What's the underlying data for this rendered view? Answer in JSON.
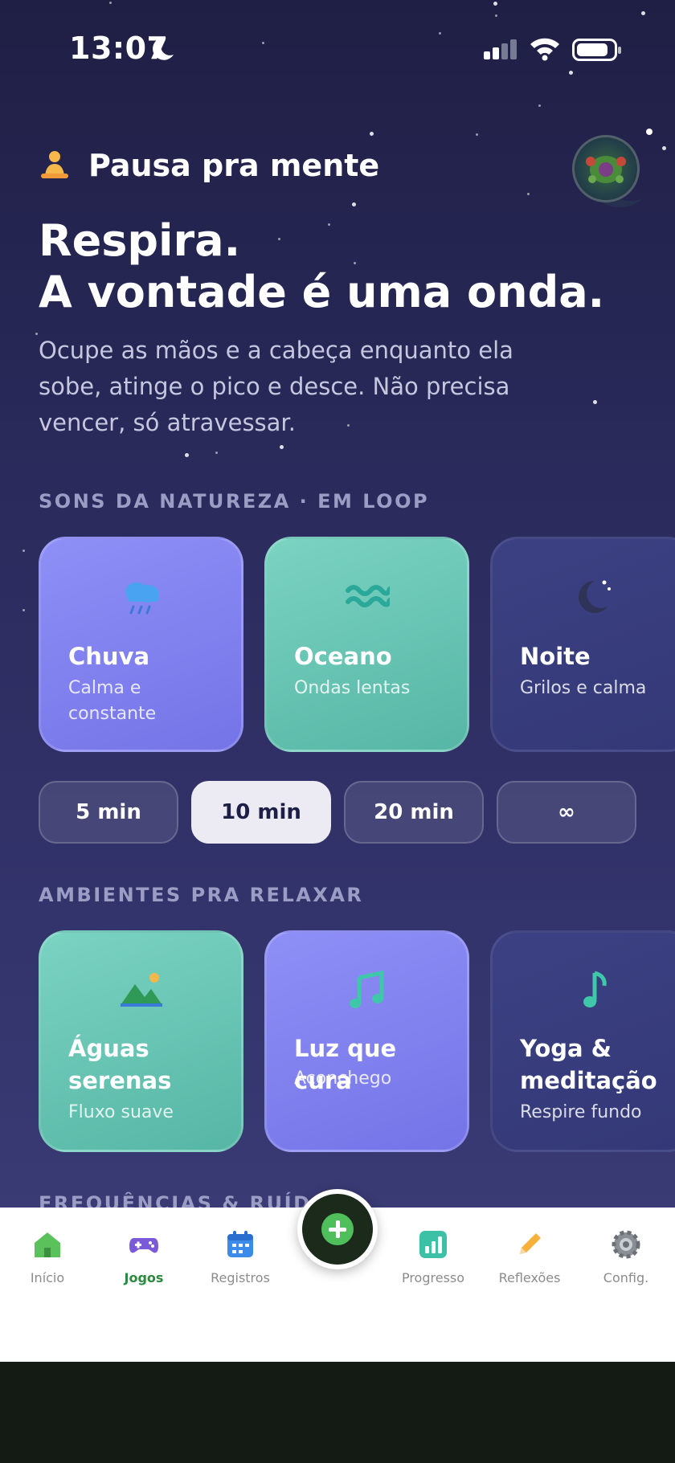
{
  "status_bar": {
    "time": "13:07"
  },
  "header": {
    "brand_title": "Pausa pra mente",
    "headline_line1": "Respira.",
    "headline_line2": "A vontade é uma onda.",
    "subtitle": "Ocupe as mãos e a cabeça enquanto ela sobe, atinge o pico e desce. Não precisa vencer, só atravessar."
  },
  "sounds_section": {
    "label": "SONS DA NATUREZA · EM LOOP",
    "cards": [
      {
        "title": "Chuva",
        "subtitle": "Calma e constante",
        "icon": "rain-cloud-icon"
      },
      {
        "title": "Oceano",
        "subtitle": "Ondas lentas",
        "icon": "waves-icon"
      },
      {
        "title": "Noite",
        "subtitle": "Grilos e calma",
        "icon": "moon-icon"
      }
    ]
  },
  "durations": {
    "options": [
      "5 min",
      "10 min",
      "20 min",
      "∞"
    ],
    "selected": "10 min"
  },
  "ambients_section": {
    "label": "AMBIENTES PRA RELAXAR",
    "cards": [
      {
        "title": "Águas serenas",
        "subtitle": "Fluxo suave",
        "icon": "landscape-icon"
      },
      {
        "title": "Luz que cura",
        "subtitle": "Aconchego",
        "icon": "music-notes-icon"
      },
      {
        "title": "Yoga & meditação",
        "subtitle": "Respire fundo",
        "icon": "music-note-icon"
      }
    ]
  },
  "next_section": {
    "label": "FREQUÊNCIAS & RUÍDO"
  },
  "nav": {
    "items": [
      {
        "label": "Início",
        "icon": "home-icon"
      },
      {
        "label": "Jogos",
        "icon": "gamepad-icon"
      },
      {
        "label": "Registros",
        "icon": "calendar-icon"
      },
      {
        "label": "Progresso",
        "icon": "chart-icon"
      },
      {
        "label": "Reflexões",
        "icon": "pencil-icon"
      },
      {
        "label": "Config.",
        "icon": "gear-icon"
      }
    ],
    "active": "Jogos",
    "fab_icon": "plus-icon"
  },
  "colors": {
    "background_top": "#1f1f45",
    "card_purple": "#8e8ff6",
    "card_teal": "#7bd3c2",
    "card_dark": "#3b4183",
    "active_nav": "#2c8a3e"
  }
}
